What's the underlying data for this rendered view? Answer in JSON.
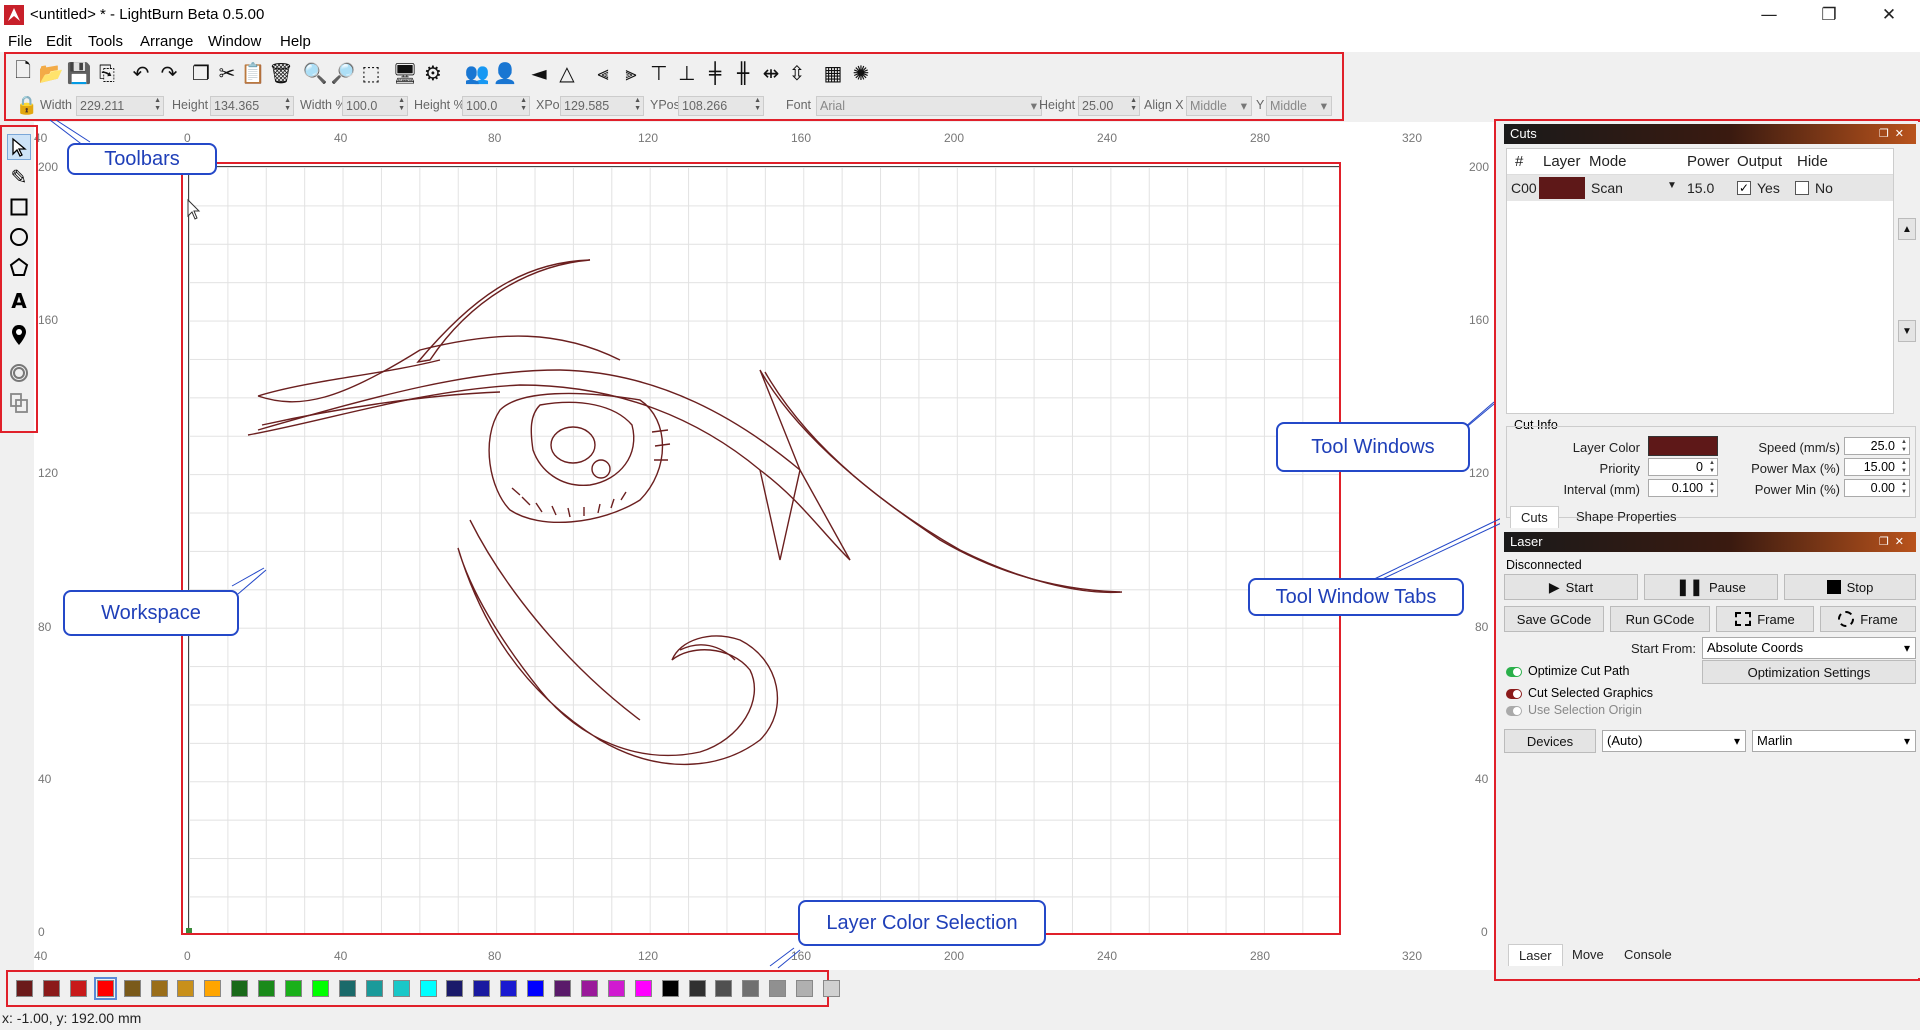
{
  "window": {
    "title": "<untitled> * - LightBurn Beta 0.5.00",
    "controls": {
      "minimize": "—",
      "maximize": "❐",
      "close": "✕"
    }
  },
  "menu": [
    "File",
    "Edit",
    "Tools",
    "Arrange",
    "Window",
    "Help"
  ],
  "toolbar": {
    "icons": [
      "new-file-icon",
      "open-file-icon",
      "save-icon",
      "import-icon",
      "undo-icon",
      "redo-icon",
      "copy-icon",
      "cut-icon",
      "paste-icon",
      "delete-icon",
      "zoom-in-icon",
      "zoom-out-icon",
      "zoom-selection-icon",
      "monitor-icon",
      "settings-icon",
      "group-icon",
      "ungroup-icon",
      "mirror-horizontal-icon",
      "mirror-vertical-icon",
      "align-left-icon",
      "align-right-icon",
      "align-top-icon",
      "align-bottom-icon",
      "align-hcenter-icon",
      "align-vcenter-icon",
      "distribute-h-icon",
      "distribute-v-icon",
      "grid-array-icon",
      "circular-array-icon"
    ]
  },
  "shape_toolbar": {
    "width_label": "Width",
    "width_value": "229.211",
    "height_label": "Height",
    "height_value": "134.365",
    "width_pct_label": "Width %",
    "width_pct_value": "100.0",
    "height_pct_label": "Height %",
    "height_pct_value": "100.0",
    "xpos_label": "XPos",
    "xpos_value": "129.585",
    "ypos_label": "YPos",
    "ypos_value": "108.266",
    "font_label": "Font",
    "font_value": "Arial",
    "text_height_label": "Height",
    "text_height_value": "25.00",
    "alignx_label": "Align X",
    "alignx_value": "Middle",
    "aligny_label": "Y",
    "aligny_value": "Middle"
  },
  "left_tools": [
    "select-icon",
    "pencil-icon",
    "rectangle-icon",
    "ellipse-icon",
    "polygon-icon",
    "text-icon",
    "position-pin-icon",
    "offset-icon",
    "boolean-icon"
  ],
  "ruler": {
    "x_top": [
      "40",
      "0",
      "40",
      "80",
      "120",
      "160",
      "200",
      "240",
      "280",
      "320"
    ],
    "x_bottom": [
      "40",
      "0",
      "40",
      "80",
      "120",
      "160",
      "200",
      "240",
      "280",
      "320"
    ],
    "y_left": [
      "200",
      "160",
      "120",
      "80",
      "40",
      "0"
    ],
    "y_right": [
      "200",
      "160",
      "120",
      "80",
      "40",
      "0"
    ]
  },
  "callouts": {
    "toolbars": "Toolbars",
    "workspace": "Workspace",
    "tool_windows": "Tool Windows",
    "tool_window_tabs": "Tool Window Tabs",
    "layer_color_selection": "Layer Color Selection"
  },
  "palette": [
    "#6b1a1a",
    "#8b1a1a",
    "#c81a1a",
    "#ff0000",
    "#7a5a1a",
    "#9a6e1a",
    "#c8901a",
    "#ffa500",
    "#1a6a1a",
    "#1a8a1a",
    "#1ab01a",
    "#00ff00",
    "#1a6a6a",
    "#1a9a9a",
    "#1ac8c8",
    "#00ffff",
    "#1a1a6a",
    "#1a1aa0",
    "#1a1ad0",
    "#0000ff",
    "#5a1a6a",
    "#9a1a9a",
    "#d01ad0",
    "#ff00ff",
    "#000000",
    "#303030",
    "#505050",
    "#707070",
    "#909090",
    "#b0b0b0",
    "#d0d0d0"
  ],
  "status": "x: -1.00, y: 192.00 mm",
  "cuts_panel": {
    "title": "Cuts",
    "headers": [
      "#",
      "Layer",
      "Mode",
      "Power",
      "Output",
      "Hide"
    ],
    "row": {
      "id": "C00",
      "layer_color": "#5e1818",
      "mode": "Scan",
      "power": "15.0",
      "output": "Yes",
      "hide": "No"
    },
    "cut_info_label": "Cut Info",
    "layer_color_label": "Layer Color",
    "priority_label": "Priority",
    "priority_value": "0",
    "interval_label": "Interval (mm)",
    "interval_value": "0.100",
    "speed_label": "Speed  (mm/s)",
    "speed_value": "25.0",
    "power_max_label": "Power Max (%)",
    "power_max_value": "15.00",
    "power_min_label": "Power Min (%)",
    "power_min_value": "0.00",
    "tabs": [
      "Cuts",
      "Shape Properties"
    ]
  },
  "laser_panel": {
    "title": "Laser",
    "status": "Disconnected",
    "start": "Start",
    "pause": "Pause",
    "stop": "Stop",
    "save_gcode": "Save GCode",
    "run_gcode": "Run GCode",
    "frame1": "Frame",
    "frame2": "Frame",
    "start_from_label": "Start From:",
    "start_from_value": "Absolute Coords",
    "optimize_label": "Optimize Cut Path",
    "optimization_settings": "Optimization Settings",
    "cut_selected_label": "Cut Selected Graphics",
    "use_selection_label": "Use Selection Origin",
    "devices": "Devices",
    "device_port": "(Auto)",
    "device_type": "Marlin",
    "tabs": [
      "Laser",
      "Move",
      "Console"
    ]
  }
}
